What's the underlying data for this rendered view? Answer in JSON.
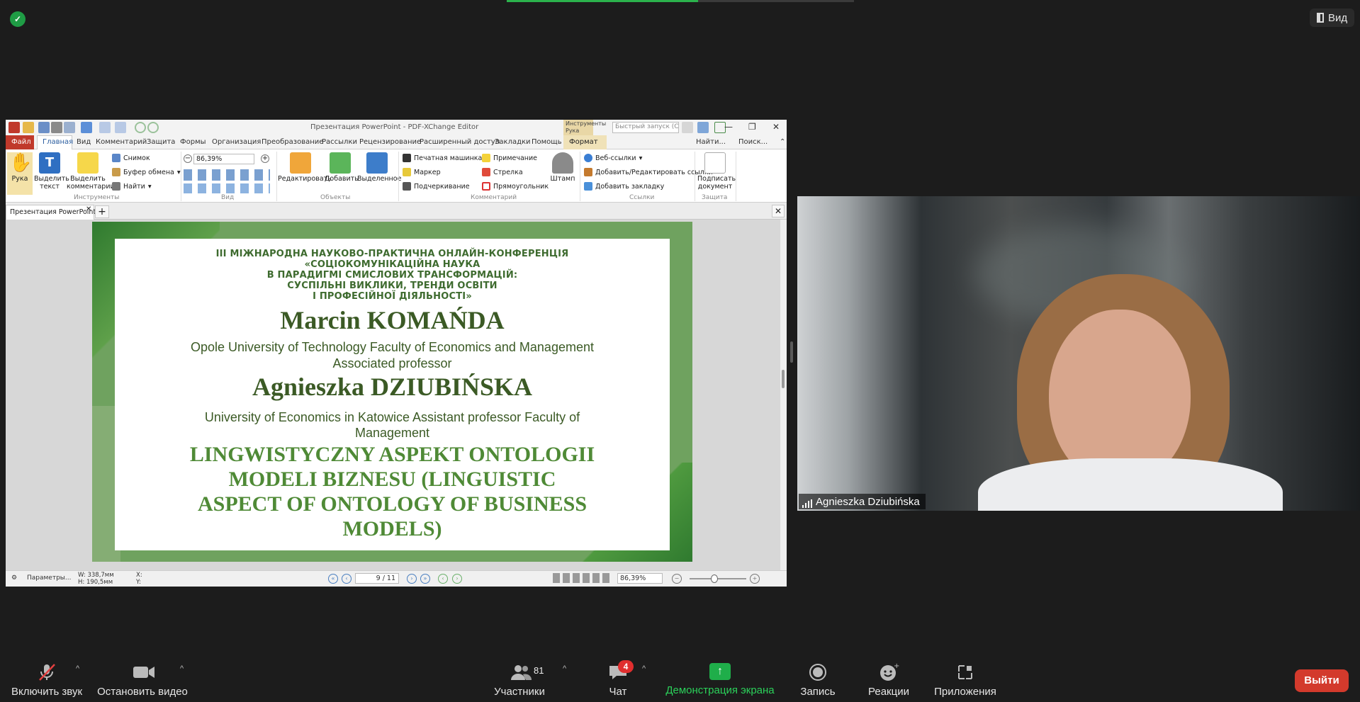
{
  "top": {
    "view_label": "Вид"
  },
  "app": {
    "title": "Презентация PowerPoint - PDF-XChange Editor",
    "quick_search_placeholder": "Быстрый запуск (Ctrl...",
    "tools_tab": "Инструменты Рука",
    "menu": {
      "file": "Файл",
      "home": "Главная",
      "items": [
        "Вид",
        "Комментарий",
        "Защита",
        "Формы",
        "Организация",
        "Преобразование",
        "Рассылки",
        "Рецензирование",
        "Расширенный доступ",
        "Закладки",
        "Помощь"
      ],
      "format": "Формат",
      "find": "Найти...",
      "search": "Поиск..."
    },
    "ribbon": {
      "hand": "Рука",
      "select_text": "Выделить текст",
      "select_comments": "Выделить комментарии",
      "snapshot": "Снимок",
      "clipboard": "Буфер обмена",
      "find": "Найти",
      "group_tools": "Инструменты",
      "zoom_value": "86,39%",
      "group_view": "Вид",
      "edit": "Редактировать",
      "add": "Добавить",
      "selected": "Выделенное",
      "group_objects": "Объекты",
      "typewriter": "Печатная машинка",
      "note": "Примечание",
      "marker": "Маркер",
      "arrow": "Стрелка",
      "underline": "Подчеркивание",
      "rectangle": "Прямоугольник",
      "stamp": "Штамп",
      "group_comments": "Комментарий",
      "web_links": "Веб-ссылки",
      "add_edit_links": "Добавить/Редактировать ссылки",
      "add_bookmark": "Добавить закладку",
      "group_links": "Ссылки",
      "sign": "Подписать документ",
      "group_protect": "Защита"
    },
    "doc_tab": "Презентация PowerPoint",
    "slide": {
      "conf_line1": "III МІЖНАРОДНА НАУКОВО-ПРАКТИЧНА ОНЛАЙН-КОНФЕРЕНЦІЯ",
      "conf_line2": "«СОЦІОКОМУНІКАЦІЙНА НАУКА",
      "conf_line3": "В ПАРАДИГМІ СМИСЛОВИХ ТРАНСФОРМАЦІЙ:",
      "conf_line4": "СУСПІЛЬНІ ВИКЛИКИ, ТРЕНДИ ОСВІТИ",
      "conf_line5": "І ПРОФЕСІЙНОЇ ДІЯЛЬНОСТІ»",
      "author1": "Marcin KOMAŃDA",
      "affil1_line1": "Opole University of Technology Faculty of Economics and Management",
      "affil1_line2": "Associated professor",
      "author2": "Agnieszka DZIUBIŃSKA",
      "affil2_line1": "University of Economics in Katowice Assistant professor Faculty of",
      "affil2_line2": "Management",
      "paper_line1": "LINGWISTYCZNY ASPEKT ONTOLOGII",
      "paper_line2": "MODELI BIZNESU (LINGUISTIC",
      "paper_line3": "ASPECT OF ONTOLOGY OF BUSINESS",
      "paper_line4": "MODELS)"
    },
    "status": {
      "params": "Параметры...",
      "w": "W: 338,7мм",
      "h": "H: 190,5мм",
      "x": "X:",
      "y": "Y:",
      "page": "9 / 11",
      "zoom": "86,39%"
    }
  },
  "participant": {
    "name": "Agnieszka Dziubińska"
  },
  "toolbar": {
    "mute": "Включить звук",
    "video": "Остановить видео",
    "participants": "Участники",
    "participants_count": "81",
    "chat": "Чат",
    "chat_badge": "4",
    "share": "Демонстрация экрана",
    "record": "Запись",
    "reactions": "Реакции",
    "apps": "Приложения",
    "leave": "Выйти"
  }
}
